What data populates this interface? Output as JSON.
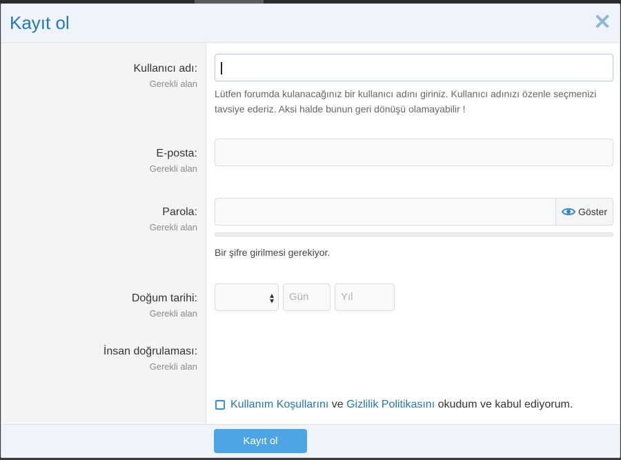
{
  "dialog": {
    "title": "Kayıt ol",
    "close_icon": "close-icon"
  },
  "fields": {
    "username": {
      "label": "Kullanıcı adı:",
      "required": "Gerekli alan",
      "value": "",
      "help": "Lütfen forumda kulanacağınız bir kullanıcı adını giriniz. Kullanıcı adınızı özenle seçmenizi tavsiye ederiz. Aksi halde bunun geri dönüşü olamayabilir !"
    },
    "email": {
      "label": "E-posta:",
      "required": "Gerekli alan",
      "value": ""
    },
    "password": {
      "label": "Parola:",
      "required": "Gerekli alan",
      "value": "",
      "show_label": "Göster",
      "help": "Bir şifre girilmesi gerekiyor."
    },
    "birthdate": {
      "label": "Doğum tarihi:",
      "required": "Gerekli alan",
      "month_value": "",
      "day_placeholder": "Gün",
      "year_placeholder": "Yıl"
    },
    "captcha": {
      "label": "İnsan doğrulaması:",
      "required": "Gerekli alan"
    }
  },
  "agreement": {
    "terms_link": "Kullanım Koşullarını",
    "and_text": "ve",
    "privacy_link": "Gizlilik Politikasını",
    "suffix": "okudum ve kabul ediyorum.",
    "checked": false
  },
  "footer": {
    "submit_label": "Kayıt ol"
  },
  "colors": {
    "accent": "#2577b1",
    "button": "#4ea5e3",
    "header_bg": "#eef4fa"
  }
}
